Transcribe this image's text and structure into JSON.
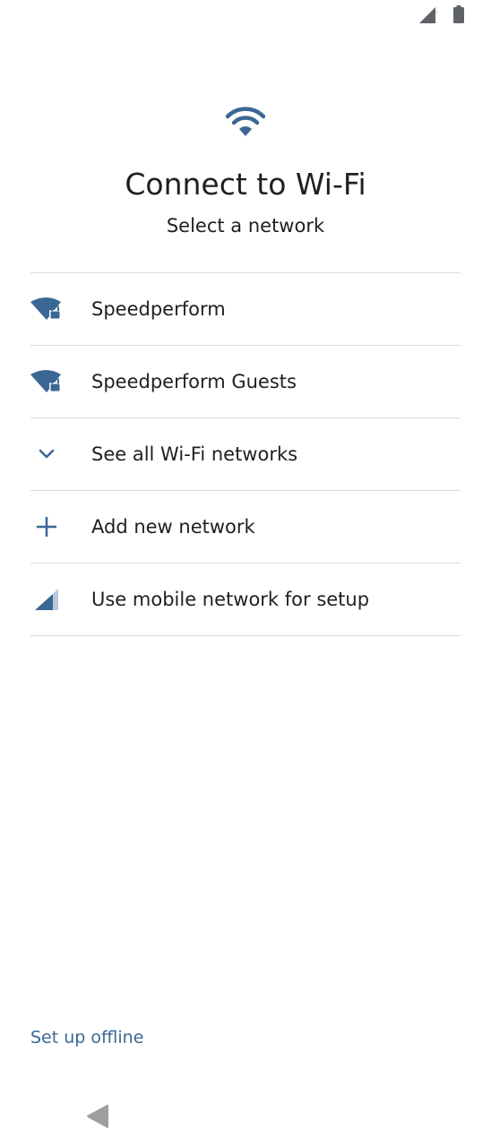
{
  "colors": {
    "accent": "#3b6794",
    "accent_light": "#b9c8d9",
    "divider": "#dadada",
    "text": "#1f1f1f",
    "nav_gray": "#9e9e9e"
  },
  "header": {
    "icon": "wifi-icon",
    "title": "Connect to Wi-Fi",
    "subtitle": "Select a network"
  },
  "networks": [
    {
      "icon": "wifi-lock-icon",
      "label": "Speedperform"
    },
    {
      "icon": "wifi-lock-icon",
      "label": "Speedperform Guests"
    }
  ],
  "actions": [
    {
      "icon": "chevron-down-icon",
      "label": "See all Wi-Fi networks"
    },
    {
      "icon": "plus-icon",
      "label": "Add new network"
    },
    {
      "icon": "cellular-signal-icon",
      "label": "Use mobile network for setup"
    }
  ],
  "footer": {
    "offline_label": "Set up offline"
  },
  "nav": {
    "back_icon": "back-triangle-icon"
  }
}
